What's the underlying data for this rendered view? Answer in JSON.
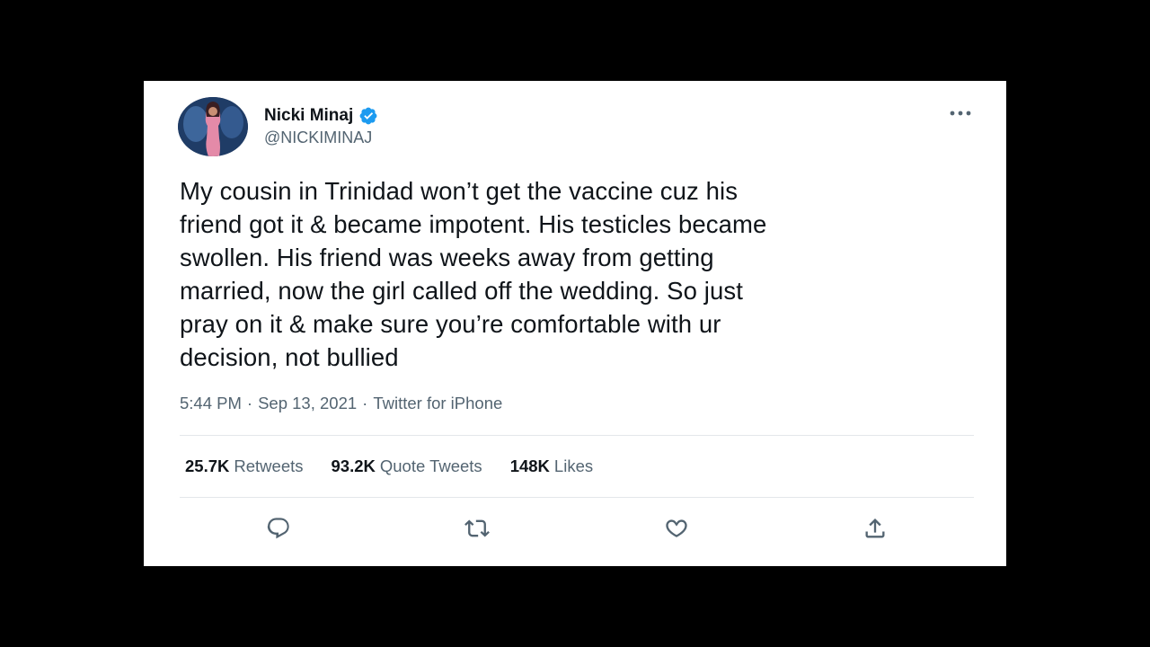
{
  "tweet": {
    "author": {
      "display_name": "Nicki Minaj",
      "handle": "@NICKIMINAJ",
      "verified": true,
      "avatar_icon": "profile-photo"
    },
    "text": "My cousin in Trinidad won’t get the vaccine cuz his\nfriend got it & became impotent. His testicles became\nswollen. His friend was weeks away from getting\nmarried, now the girl called off the wedding. So just\npray on it & make sure you’re comfortable with ur\ndecision, not bullied",
    "time": "5:44 PM",
    "date": "Sep 13, 2021",
    "separator": "·",
    "source": "Twitter for iPhone",
    "stats": {
      "retweets": {
        "count": "25.7K",
        "label": "Retweets"
      },
      "quote_tweets": {
        "count": "93.2K",
        "label": "Quote Tweets"
      },
      "likes": {
        "count": "148K",
        "label": "Likes"
      }
    },
    "actions": [
      "reply-icon",
      "retweet-icon",
      "like-icon",
      "share-icon"
    ],
    "more_icon": "more-horizontal-icon"
  },
  "colors": {
    "background": "#000000",
    "card": "#ffffff",
    "text_primary": "#0f1419",
    "text_secondary": "#536471",
    "verified_blue": "#1d9bf0",
    "divider": "#e3e7ea"
  }
}
